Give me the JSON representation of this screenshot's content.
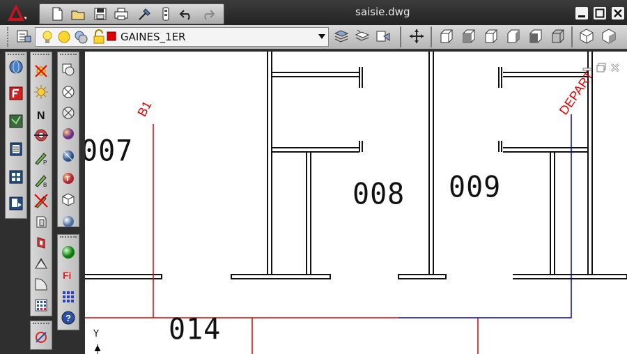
{
  "window": {
    "title": "saisie.dwg"
  },
  "toolbar": {
    "layer_name": "GAINES_1ER"
  },
  "drawing": {
    "rooms": [
      "007",
      "008",
      "009",
      "014"
    ],
    "labels": {
      "b1": "B1",
      "depart": "DEPART"
    },
    "ucs": {
      "axis": "Y"
    }
  },
  "colors": {
    "red_line": "#e00000",
    "blue_line": "#0000cc",
    "walls": "#111111"
  },
  "icons": {
    "quick_access": [
      "new-icon",
      "open-icon",
      "save-icon",
      "print-icon",
      "match-properties-icon",
      "plot-preview-icon",
      "undo-icon",
      "redo-icon"
    ],
    "layer_states": [
      "lightbulb-icon",
      "sun-icon",
      "freeze-icon",
      "lock-icon",
      "color-swatch-icon"
    ],
    "layer_tools": [
      "layer-properties-icon",
      "layer-previous-icon",
      "layer-state-icon"
    ],
    "view_tools": [
      "orbit-icon",
      "top-view-icon",
      "bottom-view-icon",
      "left-view-icon",
      "right-view-icon",
      "front-view-icon",
      "back-view-icon",
      "iso-view-icon",
      "iso-view-2-icon"
    ]
  }
}
